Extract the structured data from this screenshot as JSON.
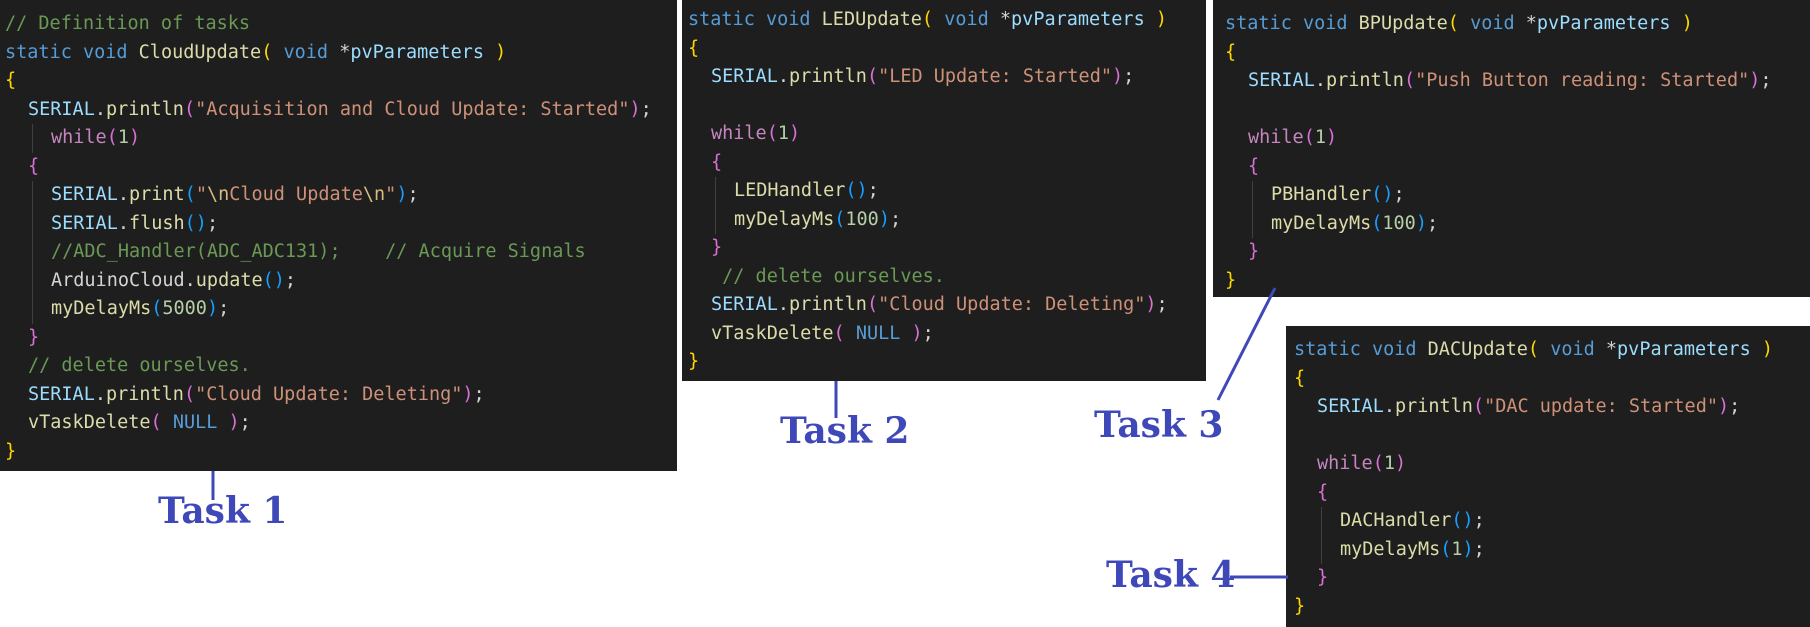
{
  "panels": [
    {
      "id": "task1",
      "lines": [
        {
          "indent": 0,
          "tokens": [
            {
              "t": "// Definition of tasks",
              "c": "cm"
            }
          ]
        },
        {
          "indent": 0,
          "tokens": [
            {
              "t": "static ",
              "c": "kw"
            },
            {
              "t": "void ",
              "c": "kw"
            },
            {
              "t": "CloudUpdate",
              "c": "fn"
            },
            {
              "t": "( ",
              "c": "p1"
            },
            {
              "t": "void ",
              "c": "kw"
            },
            {
              "t": "*",
              "c": "ty"
            },
            {
              "t": "pvParameters",
              "c": "pm"
            },
            {
              "t": " )",
              "c": "p1"
            }
          ]
        },
        {
          "indent": 0,
          "tokens": [
            {
              "t": "{",
              "c": "p1"
            }
          ]
        },
        {
          "indent": 1,
          "tokens": [
            {
              "t": "SERIAL",
              "c": "pm"
            },
            {
              "t": ".",
              "c": "ty"
            },
            {
              "t": "println",
              "c": "fn"
            },
            {
              "t": "(",
              "c": "p2"
            },
            {
              "t": "\"Acquisition and Cloud Update: Started\"",
              "c": "str"
            },
            {
              "t": ")",
              "c": "p2"
            },
            {
              "t": ";",
              "c": "ty"
            }
          ]
        },
        {
          "indent": 2,
          "tokens": [
            {
              "t": "while",
              "c": "ctl"
            },
            {
              "t": "(",
              "c": "p2"
            },
            {
              "t": "1",
              "c": "num"
            },
            {
              "t": ")",
              "c": "p2"
            }
          ]
        },
        {
          "indent": 1,
          "tokens": [
            {
              "t": "{",
              "c": "p2"
            }
          ]
        },
        {
          "indent": 2,
          "tokens": [
            {
              "t": "SERIAL",
              "c": "pm"
            },
            {
              "t": ".",
              "c": "ty"
            },
            {
              "t": "print",
              "c": "fn"
            },
            {
              "t": "(",
              "c": "p3"
            },
            {
              "t": "\"",
              "c": "str"
            },
            {
              "t": "\\n",
              "c": "esc"
            },
            {
              "t": "Cloud Update",
              "c": "str"
            },
            {
              "t": "\\n",
              "c": "esc"
            },
            {
              "t": "\"",
              "c": "str"
            },
            {
              "t": ")",
              "c": "p3"
            },
            {
              "t": ";",
              "c": "ty"
            }
          ]
        },
        {
          "indent": 2,
          "tokens": [
            {
              "t": "SERIAL",
              "c": "pm"
            },
            {
              "t": ".",
              "c": "ty"
            },
            {
              "t": "flush",
              "c": "fn"
            },
            {
              "t": "()",
              "c": "p3"
            },
            {
              "t": ";",
              "c": "ty"
            }
          ]
        },
        {
          "indent": 2,
          "tokens": [
            {
              "t": "//ADC_Handler(ADC_ADC131);    // Acquire Signals",
              "c": "cm"
            }
          ]
        },
        {
          "indent": 2,
          "tokens": [
            {
              "t": "ArduinoCloud",
              "c": "ty"
            },
            {
              "t": ".",
              "c": "ty"
            },
            {
              "t": "update",
              "c": "fn"
            },
            {
              "t": "()",
              "c": "p3"
            },
            {
              "t": ";",
              "c": "ty"
            }
          ]
        },
        {
          "indent": 2,
          "tokens": [
            {
              "t": "myDelayMs",
              "c": "fn"
            },
            {
              "t": "(",
              "c": "p3"
            },
            {
              "t": "5000",
              "c": "num"
            },
            {
              "t": ")",
              "c": "p3"
            },
            {
              "t": ";",
              "c": "ty"
            }
          ]
        },
        {
          "indent": 1,
          "tokens": [
            {
              "t": "}",
              "c": "p2"
            }
          ]
        },
        {
          "indent": 1,
          "tokens": [
            {
              "t": "// delete ourselves.",
              "c": "cm"
            }
          ]
        },
        {
          "indent": 1,
          "tokens": [
            {
              "t": "SERIAL",
              "c": "pm"
            },
            {
              "t": ".",
              "c": "ty"
            },
            {
              "t": "println",
              "c": "fn"
            },
            {
              "t": "(",
              "c": "p2"
            },
            {
              "t": "\"Cloud Update: Deleting\"",
              "c": "str"
            },
            {
              "t": ")",
              "c": "p2"
            },
            {
              "t": ";",
              "c": "ty"
            }
          ]
        },
        {
          "indent": 1,
          "tokens": [
            {
              "t": "vTaskDelete",
              "c": "fn"
            },
            {
              "t": "( ",
              "c": "p2"
            },
            {
              "t": "NULL",
              "c": "kw"
            },
            {
              "t": " )",
              "c": "p2"
            },
            {
              "t": ";",
              "c": "ty"
            }
          ]
        },
        {
          "indent": 0,
          "tokens": [
            {
              "t": "}",
              "c": "p1"
            }
          ]
        }
      ]
    },
    {
      "id": "task2",
      "lines": [
        {
          "indent": 0,
          "tokens": [
            {
              "t": "static ",
              "c": "kw"
            },
            {
              "t": "void ",
              "c": "kw"
            },
            {
              "t": "LEDUpdate",
              "c": "fn"
            },
            {
              "t": "( ",
              "c": "p1"
            },
            {
              "t": "void ",
              "c": "kw"
            },
            {
              "t": "*",
              "c": "ty"
            },
            {
              "t": "pvParameters",
              "c": "pm"
            },
            {
              "t": " )",
              "c": "p1"
            }
          ]
        },
        {
          "indent": 0,
          "tokens": [
            {
              "t": "{",
              "c": "p1"
            }
          ]
        },
        {
          "indent": 1,
          "tokens": [
            {
              "t": "SERIAL",
              "c": "pm"
            },
            {
              "t": ".",
              "c": "ty"
            },
            {
              "t": "println",
              "c": "fn"
            },
            {
              "t": "(",
              "c": "p2"
            },
            {
              "t": "\"LED Update: Started\"",
              "c": "str"
            },
            {
              "t": ")",
              "c": "p2"
            },
            {
              "t": ";",
              "c": "ty"
            }
          ]
        },
        {
          "indent": 0,
          "tokens": []
        },
        {
          "indent": 1,
          "tokens": [
            {
              "t": "while",
              "c": "ctl"
            },
            {
              "t": "(",
              "c": "p2"
            },
            {
              "t": "1",
              "c": "num"
            },
            {
              "t": ")",
              "c": "p2"
            }
          ]
        },
        {
          "indent": 1,
          "tokens": [
            {
              "t": "{",
              "c": "p2"
            }
          ]
        },
        {
          "indent": 2,
          "tokens": [
            {
              "t": "LEDHandler",
              "c": "fn"
            },
            {
              "t": "()",
              "c": "p3"
            },
            {
              "t": ";",
              "c": "ty"
            }
          ]
        },
        {
          "indent": 2,
          "tokens": [
            {
              "t": "myDelayMs",
              "c": "fn"
            },
            {
              "t": "(",
              "c": "p3"
            },
            {
              "t": "100",
              "c": "num"
            },
            {
              "t": ")",
              "c": "p3"
            },
            {
              "t": ";",
              "c": "ty"
            }
          ]
        },
        {
          "indent": 1,
          "tokens": [
            {
              "t": "}",
              "c": "p2"
            }
          ]
        },
        {
          "indent": 1,
          "tokens": [
            {
              "t": " // delete ourselves.",
              "c": "cm"
            }
          ]
        },
        {
          "indent": 1,
          "tokens": [
            {
              "t": "SERIAL",
              "c": "pm"
            },
            {
              "t": ".",
              "c": "ty"
            },
            {
              "t": "println",
              "c": "fn"
            },
            {
              "t": "(",
              "c": "p2"
            },
            {
              "t": "\"Cloud Update: Deleting\"",
              "c": "str"
            },
            {
              "t": ")",
              "c": "p2"
            },
            {
              "t": ";",
              "c": "ty"
            }
          ]
        },
        {
          "indent": 1,
          "tokens": [
            {
              "t": "vTaskDelete",
              "c": "fn"
            },
            {
              "t": "( ",
              "c": "p2"
            },
            {
              "t": "NULL",
              "c": "kw"
            },
            {
              "t": " )",
              "c": "p2"
            },
            {
              "t": ";",
              "c": "ty"
            }
          ]
        },
        {
          "indent": 0,
          "tokens": [
            {
              "t": "}",
              "c": "p1"
            }
          ]
        }
      ]
    },
    {
      "id": "task3",
      "lines": [
        {
          "indent": 0,
          "tokens": [
            {
              "t": "static ",
              "c": "kw"
            },
            {
              "t": "void ",
              "c": "kw"
            },
            {
              "t": "BPUpdate",
              "c": "fn"
            },
            {
              "t": "( ",
              "c": "p1"
            },
            {
              "t": "void ",
              "c": "kw"
            },
            {
              "t": "*",
              "c": "ty"
            },
            {
              "t": "pvParameters",
              "c": "pm"
            },
            {
              "t": " )",
              "c": "p1"
            }
          ]
        },
        {
          "indent": 0,
          "tokens": [
            {
              "t": "{",
              "c": "p1"
            }
          ]
        },
        {
          "indent": 1,
          "tokens": [
            {
              "t": "SERIAL",
              "c": "pm"
            },
            {
              "t": ".",
              "c": "ty"
            },
            {
              "t": "println",
              "c": "fn"
            },
            {
              "t": "(",
              "c": "p2"
            },
            {
              "t": "\"Push Button reading: Started\"",
              "c": "str"
            },
            {
              "t": ")",
              "c": "p2"
            },
            {
              "t": ";",
              "c": "ty"
            }
          ]
        },
        {
          "indent": 0,
          "tokens": []
        },
        {
          "indent": 1,
          "tokens": [
            {
              "t": "while",
              "c": "ctl"
            },
            {
              "t": "(",
              "c": "p2"
            },
            {
              "t": "1",
              "c": "num"
            },
            {
              "t": ")",
              "c": "p2"
            }
          ]
        },
        {
          "indent": 1,
          "tokens": [
            {
              "t": "{",
              "c": "p2"
            }
          ]
        },
        {
          "indent": 2,
          "tokens": [
            {
              "t": "PBHandler",
              "c": "fn"
            },
            {
              "t": "()",
              "c": "p3"
            },
            {
              "t": ";",
              "c": "ty"
            }
          ]
        },
        {
          "indent": 2,
          "tokens": [
            {
              "t": "myDelayMs",
              "c": "fn"
            },
            {
              "t": "(",
              "c": "p3"
            },
            {
              "t": "100",
              "c": "num"
            },
            {
              "t": ")",
              "c": "p3"
            },
            {
              "t": ";",
              "c": "ty"
            }
          ]
        },
        {
          "indent": 1,
          "tokens": [
            {
              "t": "}",
              "c": "p2"
            }
          ]
        },
        {
          "indent": 0,
          "tokens": [
            {
              "t": "}",
              "c": "p1"
            }
          ]
        }
      ]
    },
    {
      "id": "task4",
      "lines": [
        {
          "indent": 0,
          "tokens": [
            {
              "t": "static ",
              "c": "kw"
            },
            {
              "t": "void ",
              "c": "kw"
            },
            {
              "t": "DACUpdate",
              "c": "fn"
            },
            {
              "t": "( ",
              "c": "p1"
            },
            {
              "t": "void ",
              "c": "kw"
            },
            {
              "t": "*",
              "c": "ty"
            },
            {
              "t": "pvParameters",
              "c": "pm"
            },
            {
              "t": " )",
              "c": "p1"
            }
          ]
        },
        {
          "indent": 0,
          "tokens": [
            {
              "t": "{",
              "c": "p1"
            }
          ]
        },
        {
          "indent": 1,
          "tokens": [
            {
              "t": "SERIAL",
              "c": "pm"
            },
            {
              "t": ".",
              "c": "ty"
            },
            {
              "t": "println",
              "c": "fn"
            },
            {
              "t": "(",
              "c": "p2"
            },
            {
              "t": "\"DAC update: Started\"",
              "c": "str"
            },
            {
              "t": ")",
              "c": "p2"
            },
            {
              "t": ";",
              "c": "ty"
            }
          ]
        },
        {
          "indent": 0,
          "tokens": []
        },
        {
          "indent": 1,
          "tokens": [
            {
              "t": "while",
              "c": "ctl"
            },
            {
              "t": "(",
              "c": "p2"
            },
            {
              "t": "1",
              "c": "num"
            },
            {
              "t": ")",
              "c": "p2"
            }
          ]
        },
        {
          "indent": 1,
          "tokens": [
            {
              "t": "{",
              "c": "p2"
            }
          ]
        },
        {
          "indent": 2,
          "tokens": [
            {
              "t": "DACHandler",
              "c": "fn"
            },
            {
              "t": "()",
              "c": "p3"
            },
            {
              "t": ";",
              "c": "ty"
            }
          ]
        },
        {
          "indent": 2,
          "tokens": [
            {
              "t": "myDelayMs",
              "c": "fn"
            },
            {
              "t": "(",
              "c": "p3"
            },
            {
              "t": "1",
              "c": "num"
            },
            {
              "t": ")",
              "c": "p3"
            },
            {
              "t": ";",
              "c": "ty"
            }
          ]
        },
        {
          "indent": 1,
          "tokens": [
            {
              "t": "}",
              "c": "p2"
            }
          ]
        },
        {
          "indent": 0,
          "tokens": [
            {
              "t": "}",
              "c": "p1"
            }
          ]
        }
      ]
    }
  ],
  "labels": {
    "task1": "Task 1",
    "task2": "Task 2",
    "task3": "Task 3",
    "task4": "Task 4"
  },
  "colors": {
    "background": "#1e1e1e",
    "label": "#3f48b8",
    "keyword": "#569cd6",
    "function": "#dcdcaa",
    "string": "#ce9178",
    "comment": "#6a9955",
    "number": "#b5cea8",
    "control": "#c586c0"
  }
}
